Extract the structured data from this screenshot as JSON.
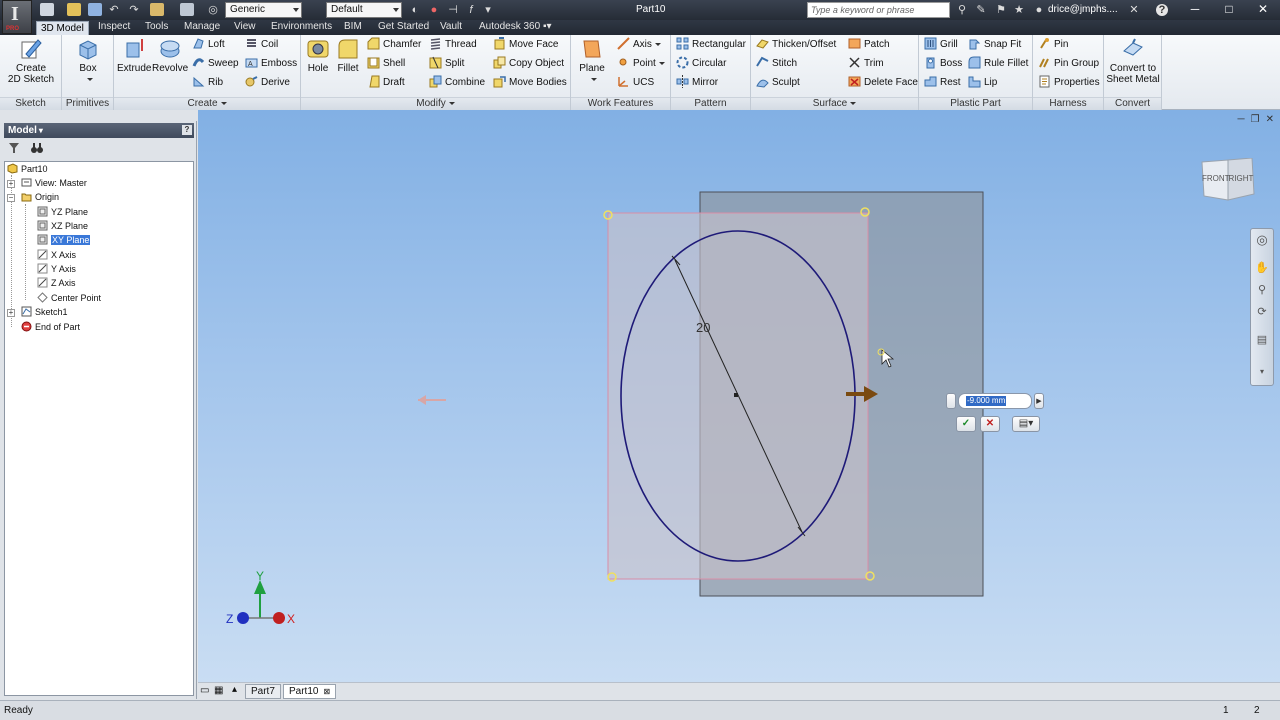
{
  "title_bar": {
    "app_logo": "I",
    "app_edition": "PRO",
    "material_value": "Generic",
    "appearance_value": "Default",
    "document_title": "Part10",
    "search_placeholder": "Type a keyword or phrase",
    "user": "drice@jmphs....",
    "help_glyph": "?"
  },
  "ribbon_tabs": [
    "3D Model",
    "Inspect",
    "Tools",
    "Manage",
    "View",
    "Environments",
    "BIM",
    "Get Started",
    "Vault",
    "Autodesk 360"
  ],
  "ribbon": {
    "sketch": {
      "title": "Sketch",
      "create_2d_sketch_l1": "Create",
      "create_2d_sketch_l2": "2D Sketch"
    },
    "primitives": {
      "title": "Primitives",
      "box": "Box"
    },
    "create": {
      "title": "Create",
      "extrude": "Extrude",
      "revolve": "Revolve",
      "loft": "Loft",
      "sweep": "Sweep",
      "rib": "Rib",
      "coil": "Coil",
      "emboss": "Emboss",
      "derive": "Derive"
    },
    "modify": {
      "title": "Modify",
      "hole": "Hole",
      "fillet": "Fillet",
      "chamfer": "Chamfer",
      "shell": "Shell",
      "draft": "Draft",
      "thread": "Thread",
      "split": "Split",
      "combine": "Combine",
      "move_face": "Move Face",
      "copy_object": "Copy Object",
      "move_bodies": "Move Bodies"
    },
    "work_features": {
      "title": "Work Features",
      "plane": "Plane",
      "axis": "Axis",
      "point": "Point",
      "ucs": "UCS"
    },
    "pattern": {
      "title": "Pattern",
      "rectangular": "Rectangular",
      "circular": "Circular",
      "mirror": "Mirror"
    },
    "surface": {
      "title": "Surface",
      "thicken_offset": "Thicken/Offset",
      "stitch": "Stitch",
      "sculpt": "Sculpt",
      "patch": "Patch",
      "trim": "Trim",
      "delete_face": "Delete Face"
    },
    "plastic_part": {
      "title": "Plastic Part",
      "grill": "Grill",
      "boss": "Boss",
      "rest": "Rest",
      "snap_fit": "Snap Fit",
      "rule_fillet": "Rule Fillet",
      "lip": "Lip"
    },
    "harness": {
      "title": "Harness",
      "pin": "Pin",
      "pin_group": "Pin Group",
      "properties": "Properties"
    },
    "convert": {
      "title": "Convert",
      "sheet_metal_l1": "Convert to",
      "sheet_metal_l2": "Sheet Metal"
    }
  },
  "browser": {
    "header": "Model",
    "help": "?",
    "tree": [
      {
        "label": "Part10"
      },
      {
        "label": "View: Master"
      },
      {
        "label": "Origin"
      },
      {
        "label": "YZ Plane"
      },
      {
        "label": "XZ Plane"
      },
      {
        "label": "XY Plane",
        "selected": true
      },
      {
        "label": "X Axis"
      },
      {
        "label": "Y Axis"
      },
      {
        "label": "Z Axis"
      },
      {
        "label": "Center Point"
      },
      {
        "label": "Sketch1"
      },
      {
        "label": "End of Part"
      }
    ]
  },
  "viewport": {
    "viewcube_front": "FRONT",
    "viewcube_right": "RIGHT",
    "dimension_label": "20",
    "extrude_distance": "-9.000 mm",
    "axis_labels": {
      "x": "X",
      "y": "Y",
      "z": "Z"
    }
  },
  "doc_tabs": [
    "Part7",
    "Part10"
  ],
  "status": {
    "text": "Ready",
    "count1": "1",
    "count2": "2"
  },
  "colors": {
    "accent": "#3a78d8",
    "viewport_top": "#82b0e4",
    "viewport_bottom": "#c9ddf3",
    "sketch_circle": "#1e1a78",
    "axis_x": "#d02020",
    "axis_y": "#20a040",
    "axis_z": "#2030c0"
  }
}
